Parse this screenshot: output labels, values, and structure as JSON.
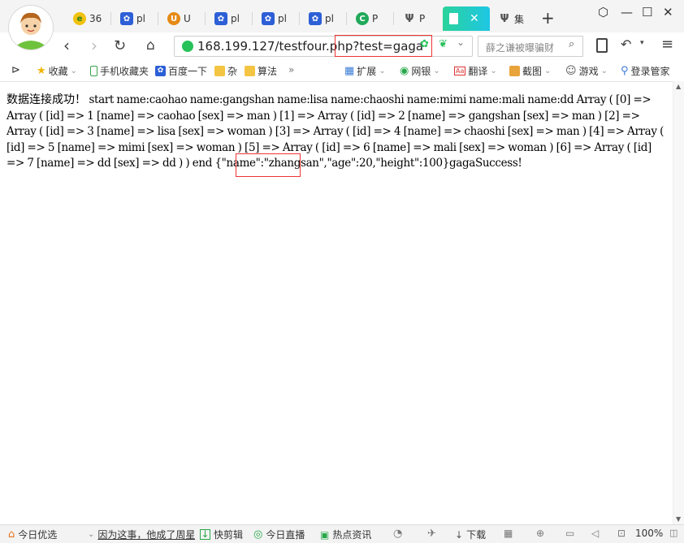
{
  "tabs": [
    {
      "label": "36",
      "icon": "browser-360-icon",
      "color": "#f1c20f"
    },
    {
      "label": "pl",
      "icon": "paw-icon",
      "color": "#2d5fd6"
    },
    {
      "label": "U",
      "icon": "uc-icon",
      "color": "#e58a16"
    },
    {
      "label": "pl",
      "icon": "paw-icon",
      "color": "#2d5fd6"
    },
    {
      "label": "pl",
      "icon": "paw-icon",
      "color": "#2d5fd6"
    },
    {
      "label": "pl",
      "icon": "paw-icon",
      "color": "#2d5fd6"
    },
    {
      "label": "P",
      "icon": "c-logo-icon",
      "color": "#21a95a"
    },
    {
      "label": "P",
      "icon": "psi-icon",
      "color": "#666666"
    },
    {
      "label": "",
      "icon": "page-icon",
      "color": "#ffffff",
      "active": true
    },
    {
      "label": "集",
      "icon": "psi-icon",
      "color": "#666666"
    }
  ],
  "address": {
    "url": "168.199.127/testfour.php?test=gaga",
    "search_placeholder": "薛之谦被曝骗财"
  },
  "bookmarks": [
    {
      "label": "收藏",
      "icon": "star-icon"
    },
    {
      "label": "手机收藏夹",
      "icon": "phone-icon"
    },
    {
      "label": "百度一下",
      "icon": "paw-icon"
    },
    {
      "label": "杂",
      "icon": "folder-icon"
    },
    {
      "label": "算法",
      "icon": "folder-icon"
    }
  ],
  "bookmarks_more": "»",
  "tools": [
    {
      "label": "扩展",
      "icon": "extension-icon"
    },
    {
      "label": "网银",
      "icon": "bank-icon"
    },
    {
      "label": "翻译",
      "icon": "translate-icon"
    },
    {
      "label": "截图",
      "icon": "screenshot-icon"
    },
    {
      "label": "游戏",
      "icon": "game-icon"
    },
    {
      "label": "登录管家",
      "icon": "login-icon"
    }
  ],
  "page": {
    "status_cn": "数据连接成功！",
    "body_text": "start name:caohao name:gangshan name:lisa name:chaoshi name:mimi name:mali name:dd Array ( [0] => Array ( [id] => 1 [name] => caohao [sex] => man ) [1] => Array ( [id] => 2 [name] => gangshan [sex] => man ) [2] => Array ( [id] => 3 [name] => lisa [sex] => woman ) [3] => Array ( [id] => 4 [name] => chaoshi [sex] => man ) [4] => Array ( [id] => 5 [name] => mimi [sex] => woman ) [5] => Array ( [id] => 6 [name] => mali [sex] => woman ) [6] => Array ( [id] => 7 [name] => dd [sex] => dd ) ) end",
    "json_text": "{\"name\":\"zhangsan\",\"age\":20,\"height\":100}gaga",
    "success_text": "Success!"
  },
  "status_bar": {
    "today_pick": "今日优选",
    "news_headline": "因为这事，他成了周星",
    "quick_cut": "快剪辑",
    "live": "今日直播",
    "hot_news": "热点资讯",
    "download": "下载",
    "zoom": "100%"
  },
  "colors": {
    "active_tab_start": "#2ad39b",
    "active_tab_end": "#1ec6e4",
    "highlight": "#ee3333",
    "secure": "#27c15a"
  }
}
